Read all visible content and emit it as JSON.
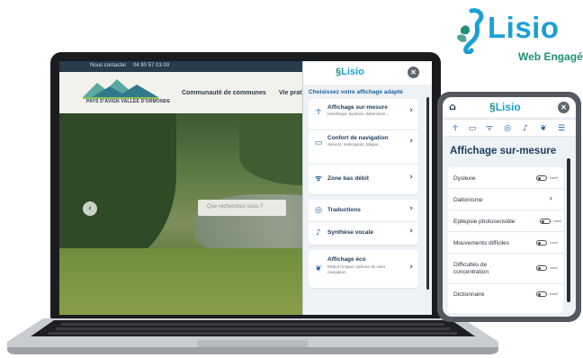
{
  "brand": {
    "name": "Lisio",
    "tagline": "Web Engagé",
    "accent": "#1ba0d6",
    "secondary": "#1f8f7a"
  },
  "website": {
    "topbar": {
      "contact": "Nous contacter",
      "phone": "04 90 57 03 00"
    },
    "logo_text": "PAYS D'AVIGN VALLÉE D'ORMONDE",
    "nav": [
      "Communauté de communes",
      "Vie prat"
    ],
    "search_placeholder": "Que recherchez-vous ?",
    "prev_icon": "chevron-left-icon"
  },
  "laptop_panel": {
    "logo": "Lisio",
    "close_icon": "close-icon",
    "subtitle": "Choisissez votre affichage adapté",
    "cards": [
      {
        "items": [
          {
            "icon": "accessibility-icon",
            "title": "Affichage sur-mesure",
            "desc": "Handicaps, dyslexie, daltonisme..."
          },
          {
            "icon": "monitor-icon",
            "title": "Confort de navigation",
            "desc": "Seniors, malvoyants, fatigue..."
          },
          {
            "icon": "wifi-icon",
            "title": "Zone bas débit",
            "desc": ""
          }
        ]
      },
      {
        "items": [
          {
            "icon": "translate-icon",
            "title": "Traductions",
            "desc": ""
          },
          {
            "icon": "speaker-icon",
            "title": "Synthèse vocale",
            "desc": ""
          }
        ]
      },
      {
        "items": [
          {
            "icon": "leaf-icon",
            "title": "Affichage éco",
            "desc": "Réduit l'impact carbone de votre navigation"
          }
        ]
      }
    ]
  },
  "phone_panel": {
    "logo": "Lisio",
    "home_icon": "home-icon",
    "close_icon": "close-icon",
    "tabs": [
      "accessibility-icon",
      "monitor-icon",
      "wifi-icon",
      "translate-icon",
      "speaker-icon",
      "leaf-icon",
      "settings-icon"
    ],
    "title": "Affichage sur-mesure",
    "rows": [
      {
        "label": "Dyslexie",
        "control": "toggle",
        "state": "inactif"
      },
      {
        "label": "Daltonisme",
        "control": "chevron"
      },
      {
        "label": "Epilepsie photosensible",
        "control": "toggle",
        "state": "inactif"
      },
      {
        "label": "Mouvements difficiles",
        "control": "toggle",
        "state": "inactif"
      },
      {
        "label": "Difficultés de concentration",
        "control": "toggle",
        "state": "inactif"
      },
      {
        "label": "Dictionnaire",
        "control": "toggle",
        "state": "inactif"
      }
    ]
  }
}
